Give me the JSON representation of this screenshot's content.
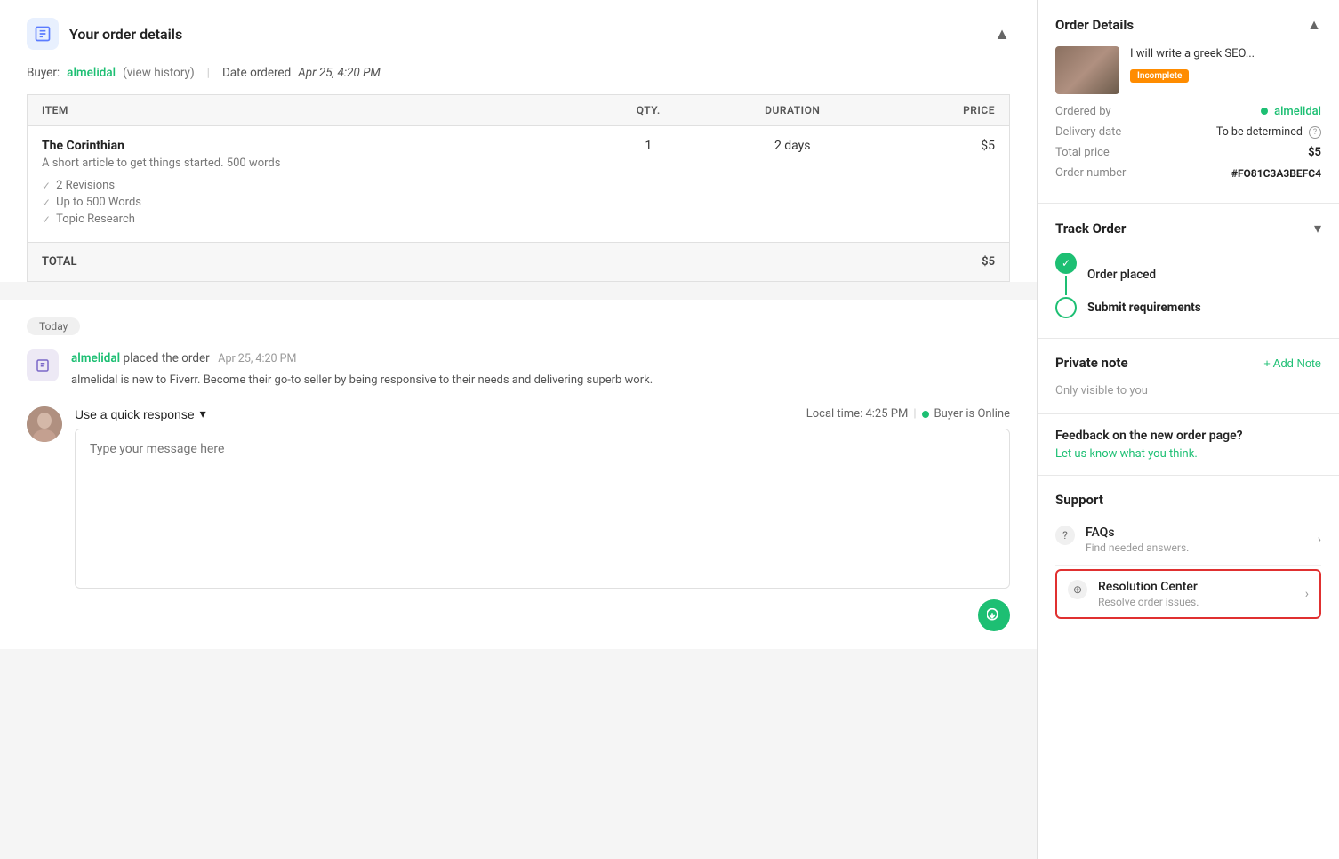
{
  "header": {
    "title": "Your order details",
    "collapse_label": "▲"
  },
  "order": {
    "buyer_label": "Buyer:",
    "buyer_name": "almelidal",
    "view_history": "(view history)",
    "date_label": "Date ordered",
    "date_value": "Apr 25, 4:20 PM",
    "table": {
      "columns": [
        "ITEM",
        "QTY.",
        "DURATION",
        "PRICE"
      ],
      "rows": [
        {
          "name": "The Corinthian",
          "description": "A short article to get things started. 500 words",
          "features": [
            "2 Revisions",
            "Up to 500 Words",
            "Topic Research"
          ],
          "qty": 1,
          "duration": "2 days",
          "price": "$5"
        }
      ],
      "total_label": "TOTAL",
      "total_value": "$5"
    }
  },
  "chat": {
    "today_label": "Today",
    "activity": {
      "actor": "almelidal",
      "action": " placed the order",
      "time": "Apr 25, 4:20 PM",
      "message": "almelidal is new to Fiverr. Become their go-to seller by being responsive to their needs and delivering superb work."
    },
    "compose": {
      "quick_response_label": "Use a quick response",
      "local_time_label": "Local time: 4:25 PM",
      "online_label": "Buyer is Online",
      "placeholder": "Type your message here"
    }
  },
  "sidebar": {
    "order_details": {
      "title": "Order Details",
      "gig_title": "I will write a greek SEO...",
      "status_badge": "Incomplete",
      "ordered_by_label": "Ordered by",
      "ordered_by_value": "almelidal",
      "delivery_date_label": "Delivery date",
      "delivery_date_value": "To be determined",
      "total_price_label": "Total price",
      "total_price_value": "$5",
      "order_number_label": "Order number",
      "order_number_value": "#FO81C3A3BEFC4"
    },
    "track_order": {
      "title": "Track Order",
      "steps": [
        {
          "label": "Order placed",
          "done": true
        },
        {
          "label": "Submit requirements",
          "done": false
        }
      ]
    },
    "private_note": {
      "title": "Private note",
      "add_button": "+ Add Note",
      "description": "Only visible to you"
    },
    "feedback": {
      "title": "Feedback on the new order page?",
      "link_text": "Let us know what you think."
    },
    "support": {
      "title": "Support",
      "items": [
        {
          "icon": "?",
          "title": "FAQs",
          "desc": "Find needed answers."
        }
      ],
      "resolution_center": {
        "icon": "⊕",
        "title": "Resolution Center",
        "desc": "Resolve order issues."
      }
    }
  }
}
